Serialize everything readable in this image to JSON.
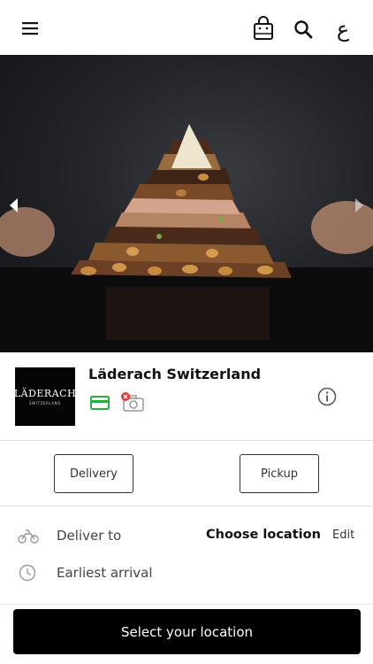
{
  "header": {
    "menu_icon": "hamburger-menu-icon",
    "bag_icon": "shopping-bag-icon",
    "search_icon": "search-icon",
    "language_label": "ع"
  },
  "hero": {
    "icons": {
      "prev": "chevron-left-icon",
      "next": "chevron-right-icon"
    }
  },
  "store": {
    "name": "Läderach Switzerland",
    "logo_text": "LÄDERACH",
    "logo_subtext": "SWITZERLAND",
    "payment_icon": "credit-card-icon",
    "camera_icon": "camera-unavailable-icon",
    "info_icon": "info-icon",
    "colors": {
      "card": "#2eaa3f",
      "error": "#e53935"
    }
  },
  "modes": {
    "delivery_label": "Delivery",
    "pickup_label": "Pickup"
  },
  "delivery": {
    "deliver_to_label": "Deliver to",
    "location_value": "Choose location",
    "edit_label": "Edit",
    "earliest_arrival_label": "Earliest arrival",
    "icons": {
      "deliver": "scooter-icon",
      "arrival": "clock-icon"
    }
  },
  "cta": {
    "label": "Select your location"
  }
}
